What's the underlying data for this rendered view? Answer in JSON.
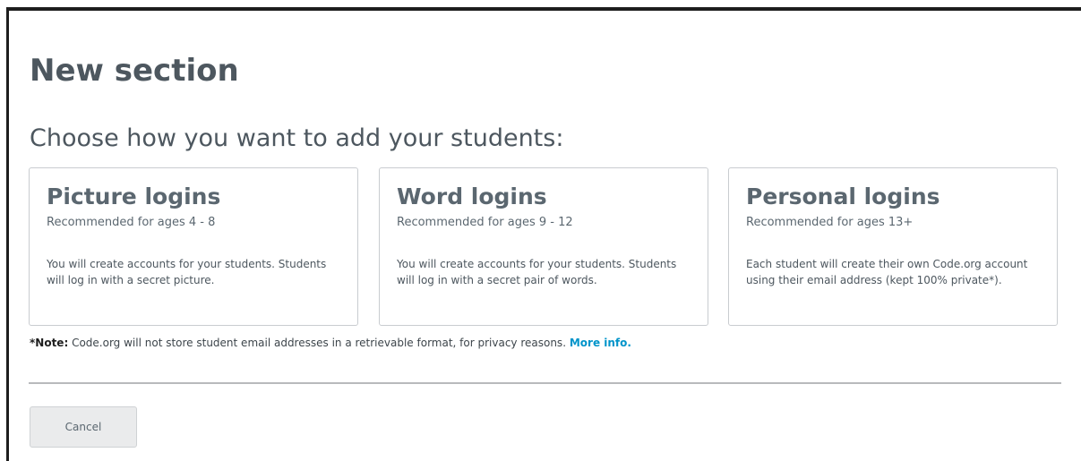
{
  "dialog": {
    "title": "New section",
    "subtitle": "Choose how you want to add your students:"
  },
  "cards": [
    {
      "title": "Picture logins",
      "recommended": "Recommended for ages 4 - 8",
      "description": "You will create accounts for your students. Students will log in with a secret picture."
    },
    {
      "title": "Word logins",
      "recommended": "Recommended for ages 9 - 12",
      "description": "You will create accounts for your students. Students will log in with a secret pair of words."
    },
    {
      "title": "Personal logins",
      "recommended": "Recommended for ages 13+",
      "description": "Each student will create their own Code.org account using their email address (kept 100% private*)."
    }
  ],
  "note": {
    "label": "*Note:",
    "text": "Code.org will not store student email addresses in a retrievable format, for privacy reasons.",
    "link": "More info."
  },
  "footer": {
    "cancel_label": "Cancel"
  },
  "colors": {
    "heading": "#4d575f",
    "text": "#5b6770",
    "link": "#0094ca",
    "card_border": "#c9ccd0",
    "button_bg": "#eaebec"
  }
}
